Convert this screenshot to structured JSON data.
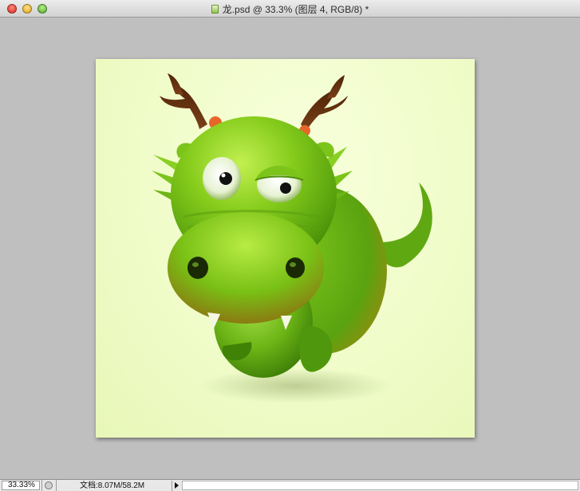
{
  "window": {
    "title": "龙.psd @ 33.3% (图层 4, RGB/8) *"
  },
  "icons": {
    "close": "close-icon",
    "minimize": "minimize-icon",
    "zoom": "zoom-icon",
    "document": "psd-document-icon",
    "status": "status-info-icon",
    "menu": "triangle-right-icon"
  },
  "colors": {
    "canvas_background": "#f0fcc9",
    "workspace_gray": "#bfbfbf",
    "dragon_green": "#7cc41a",
    "antler_brown": "#6b3410"
  },
  "statusbar": {
    "zoom": "33.33%",
    "doc_info": "文档:8.07M/58.2M"
  }
}
